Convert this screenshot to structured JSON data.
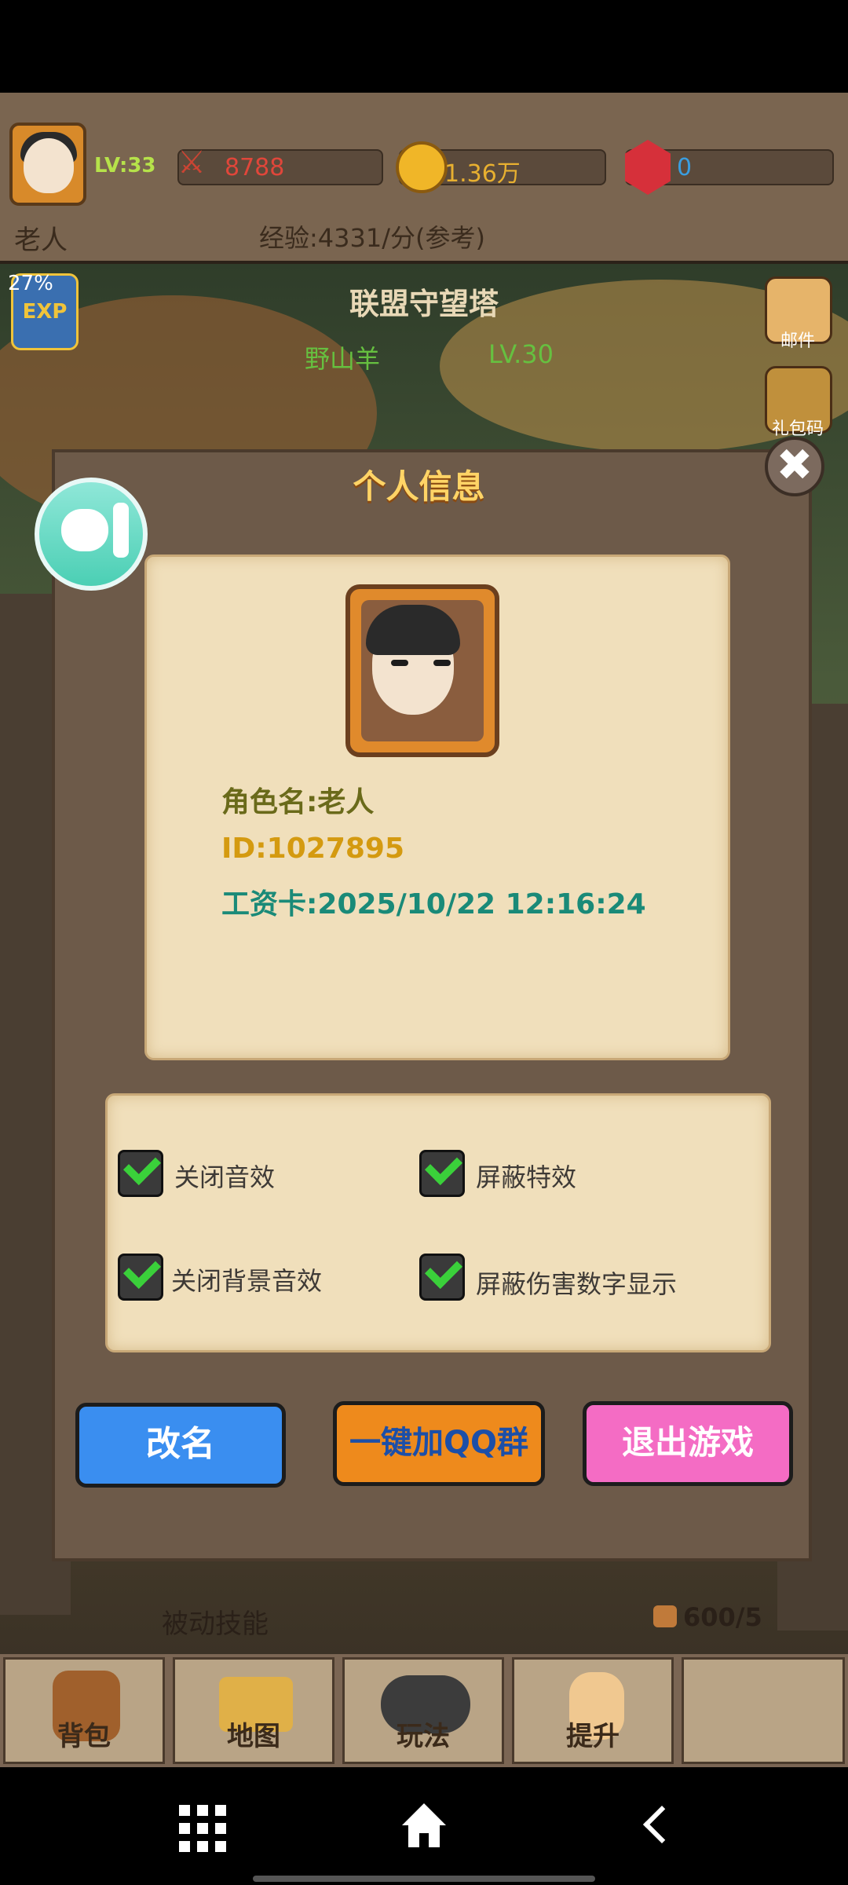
{
  "hud": {
    "level": "LV:33",
    "power": "8788",
    "gold": "1.36万",
    "gems": "0",
    "player_name": "老人",
    "exp_rate": "经验:4331/分(参考)"
  },
  "scene": {
    "exp_percent": "27%",
    "exp_icon_text": "EXP",
    "tower_name": "联盟守望塔",
    "boss_name": "野山羊",
    "boss_level": "LV.30",
    "mail_label": "邮件",
    "gift_label": "礼包码",
    "passive_skill": "被动技能",
    "stamina": "600/5"
  },
  "modal": {
    "title": "个人信息",
    "close_symbol": "✖",
    "character_name": "角色名:老人",
    "id": "ID:1027895",
    "salary_card": "工资卡:2025/10/22 12:16:24",
    "settings": [
      {
        "label": "关闭音效",
        "checked": true
      },
      {
        "label": "屏蔽特效",
        "checked": true
      },
      {
        "label": "关闭背景音效",
        "checked": true
      },
      {
        "label": "屏蔽伤害数字显示",
        "checked": true
      }
    ],
    "buttons": {
      "rename": "改名",
      "join_qq": "一键加QQ群",
      "exit": "退出游戏"
    }
  },
  "bottom_nav": [
    "背包",
    "地图",
    "玩法",
    "提升"
  ],
  "colors": {
    "modal_bg": "#6d5a49",
    "parchment": "#f0dfbb",
    "rename_btn": "#3a8ef0",
    "qq_btn": "#ee8a1c",
    "exit_btn": "#f46cc4",
    "title_gold": "#ffd466"
  }
}
